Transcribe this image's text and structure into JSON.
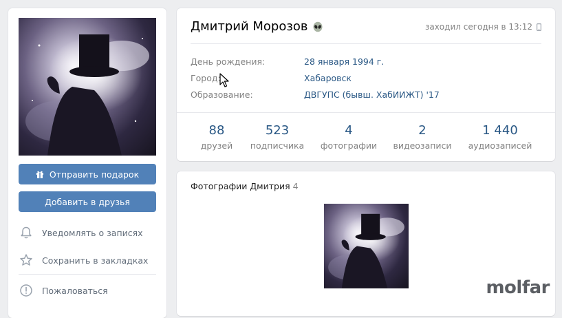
{
  "left": {
    "gift_button": "Отправить подарок",
    "add_friend_button": "Добавить в друзья",
    "actions": [
      {
        "label": "Уведомлять о записях",
        "icon": "bell-icon"
      },
      {
        "label": "Сохранить в закладках",
        "icon": "star-icon"
      },
      {
        "label": "Пожаловаться",
        "icon": "report-icon"
      }
    ]
  },
  "profile": {
    "name": "Дмитрий Морозов",
    "name_emoji": "alien-emoji",
    "last_seen": "заходил сегодня в 13:12",
    "info": [
      {
        "label": "День рождения:",
        "value": "28 января 1994 г."
      },
      {
        "label": "Город:",
        "value": "Хабаровск"
      },
      {
        "label": "Образование:",
        "value": "ДВГУПС (бывш. ХабИИЖТ) '17"
      }
    ],
    "counters": [
      {
        "num": "88",
        "label": "друзей"
      },
      {
        "num": "523",
        "label": "подписчика"
      },
      {
        "num": "4",
        "label": "фотографии"
      },
      {
        "num": "2",
        "label": "видеозаписи"
      },
      {
        "num": "1 440",
        "label": "аудиозаписей"
      }
    ]
  },
  "photos": {
    "title": "Фотографии Дмитрия",
    "count": "4"
  },
  "watermark": "molfar",
  "colors": {
    "accent": "#5181b8",
    "link": "#2a5885",
    "muted": "#828282",
    "background": "#edeef0"
  }
}
